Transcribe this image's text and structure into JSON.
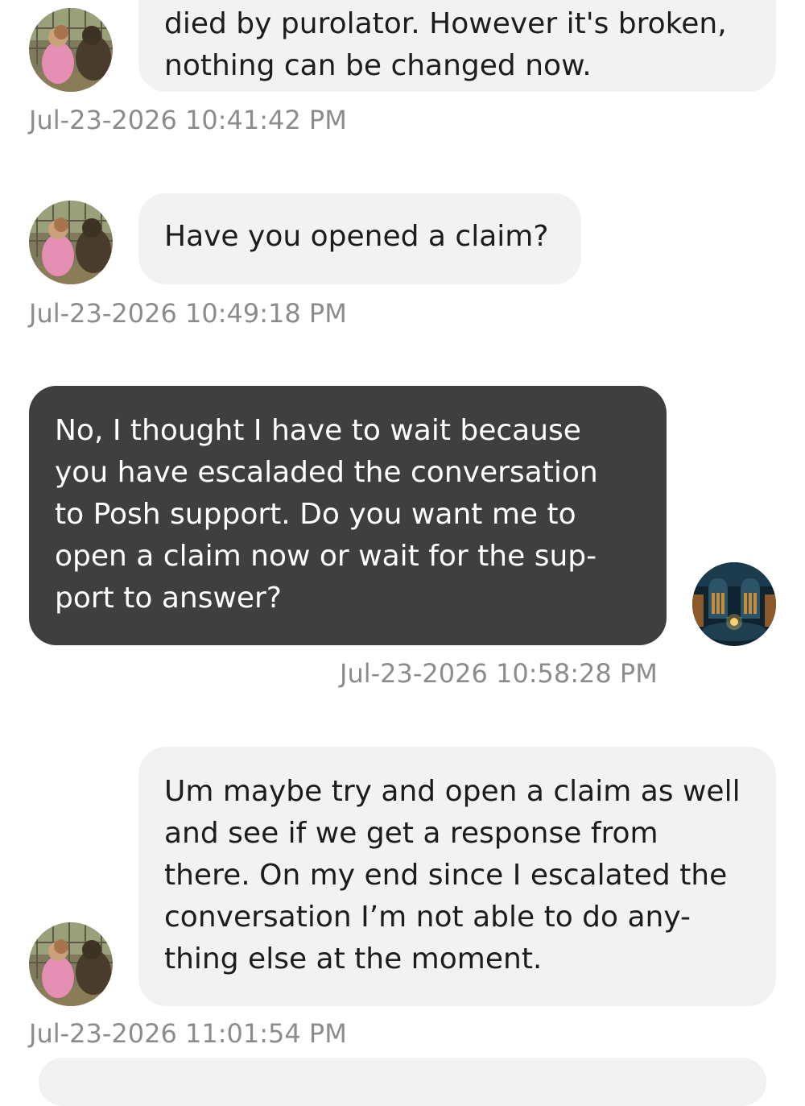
{
  "conversation": {
    "messages": [
      {
        "sender": "other",
        "text": "died by purolator. However it's broken,\nnothing can be changed now.",
        "timestamp": "Jul-23-2026 10:41:42 PM"
      },
      {
        "sender": "other",
        "text": "Have you opened a claim?",
        "timestamp": "Jul-23-2026 10:49:18 PM"
      },
      {
        "sender": "me",
        "text": "No, I thought I have to wait because\nyou have escaladed the conversation\nto Posh support. Do you want me to\nopen a claim now or wait for the sup-\nport to answer?",
        "timestamp": "Jul-23-2026 10:58:28 PM"
      },
      {
        "sender": "other",
        "text": "Um maybe try and open a claim as well\nand see if we get a response from\nthere. On my end since I escalated the\nconversation I’m not able to do any-\nthing else at the moment.",
        "timestamp": "Jul-23-2026 11:01:54 PM"
      }
    ],
    "avatars": {
      "other": "child-with-animal-photo",
      "me": "library-room-photo"
    }
  }
}
